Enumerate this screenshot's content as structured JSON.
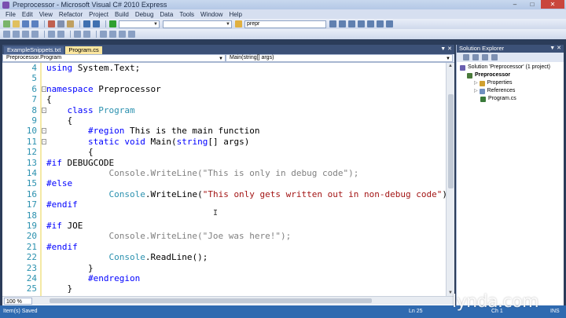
{
  "window": {
    "title": "Preprocessor - Microsoft Visual C# 2010 Express"
  },
  "menu": [
    "File",
    "Edit",
    "View",
    "Refactor",
    "Project",
    "Build",
    "Debug",
    "Data",
    "Tools",
    "Window",
    "Help"
  ],
  "toolbar": {
    "find_value": "prepr"
  },
  "tabs": [
    {
      "label": "ExampleSnippets.txt",
      "active": false
    },
    {
      "label": "Program.cs",
      "active": true
    }
  ],
  "nav": {
    "class_combo": "Preprocessor.Program",
    "member_combo": "Main(string[] args)"
  },
  "code_lines": [
    {
      "num": "4",
      "fold": "",
      "parts": [
        [
          "kw",
          "using"
        ],
        [
          "t",
          " System.Text;"
        ]
      ]
    },
    {
      "num": "5",
      "fold": "",
      "parts": []
    },
    {
      "num": "6",
      "fold": "-",
      "parts": [
        [
          "kw",
          "namespace"
        ],
        [
          "t",
          " Preprocessor"
        ]
      ]
    },
    {
      "num": "7",
      "fold": "",
      "parts": [
        [
          "t",
          "{"
        ]
      ]
    },
    {
      "num": "8",
      "fold": "-",
      "parts": [
        [
          "t",
          "    "
        ],
        [
          "kw",
          "class"
        ],
        [
          "t",
          " "
        ],
        [
          "ty",
          "Program"
        ]
      ]
    },
    {
      "num": "9",
      "fold": "",
      "parts": [
        [
          "t",
          "    {"
        ]
      ]
    },
    {
      "num": "10",
      "fold": "-",
      "parts": [
        [
          "t",
          "        "
        ],
        [
          "kw",
          "#region"
        ],
        [
          "t",
          " This is the main function"
        ]
      ]
    },
    {
      "num": "11",
      "fold": "-",
      "parts": [
        [
          "t",
          "        "
        ],
        [
          "kw",
          "static"
        ],
        [
          "t",
          " "
        ],
        [
          "kw",
          "void"
        ],
        [
          "t",
          " Main("
        ],
        [
          "kw",
          "string"
        ],
        [
          "t",
          "[] args)"
        ]
      ]
    },
    {
      "num": "12",
      "fold": "",
      "parts": [
        [
          "t",
          "        {"
        ]
      ]
    },
    {
      "num": "13",
      "fold": "",
      "parts": [
        [
          "kw",
          "#if"
        ],
        [
          "t",
          " DEBUGCODE"
        ]
      ]
    },
    {
      "num": "14",
      "fold": "",
      "parts": [
        [
          "gray",
          "            Console.WriteLine(\"This is only in debug code\");"
        ]
      ]
    },
    {
      "num": "15",
      "fold": "",
      "parts": [
        [
          "kw",
          "#else"
        ]
      ]
    },
    {
      "num": "16",
      "fold": "",
      "parts": [
        [
          "t",
          "            "
        ],
        [
          "ty",
          "Console"
        ],
        [
          "t",
          ".WriteLine("
        ],
        [
          "str",
          "\"This only gets written out in non-debug code\""
        ],
        [
          "t",
          ");"
        ]
      ]
    },
    {
      "num": "17",
      "fold": "",
      "parts": [
        [
          "kw",
          "#endif"
        ]
      ]
    },
    {
      "num": "18",
      "fold": "",
      "parts": []
    },
    {
      "num": "19",
      "fold": "",
      "parts": [
        [
          "kw",
          "#if"
        ],
        [
          "t",
          " JOE"
        ]
      ]
    },
    {
      "num": "20",
      "fold": "",
      "parts": [
        [
          "gray",
          "            Console.WriteLine(\"Joe was here!\");"
        ]
      ]
    },
    {
      "num": "21",
      "fold": "",
      "parts": [
        [
          "kw",
          "#endif"
        ]
      ]
    },
    {
      "num": "22",
      "fold": "",
      "parts": [
        [
          "t",
          "            "
        ],
        [
          "ty",
          "Console"
        ],
        [
          "t",
          ".ReadLine();"
        ]
      ]
    },
    {
      "num": "23",
      "fold": "",
      "parts": [
        [
          "t",
          "        }"
        ]
      ]
    },
    {
      "num": "24",
      "fold": "",
      "parts": [
        [
          "t",
          "        "
        ],
        [
          "kw",
          "#endregion"
        ]
      ]
    },
    {
      "num": "25",
      "fold": "",
      "parts": [
        [
          "t",
          "    }"
        ]
      ]
    }
  ],
  "zoom": "100 %",
  "solution_explorer": {
    "title": "Solution Explorer",
    "nodes": [
      {
        "label": "Solution 'Preprocessor' (1 project)",
        "indent": 0,
        "icon": "solution-icon",
        "color": "#6a5fb0"
      },
      {
        "label": "Preprocessor",
        "indent": 1,
        "icon": "project-icon",
        "color": "#4a7a3a",
        "bold": true
      },
      {
        "label": "Properties",
        "indent": 2,
        "icon": "properties-icon",
        "color": "#d0a030"
      },
      {
        "label": "References",
        "indent": 2,
        "icon": "references-icon",
        "color": "#7090c0"
      },
      {
        "label": "Program.cs",
        "indent": 2,
        "icon": "csharp-file-icon",
        "color": "#3a7a3a"
      }
    ]
  },
  "status": {
    "message": "Item(s) Saved",
    "ln": "Ln 25",
    "col": "Ch 1",
    "ins": "INS"
  },
  "watermark": "lynda.com"
}
